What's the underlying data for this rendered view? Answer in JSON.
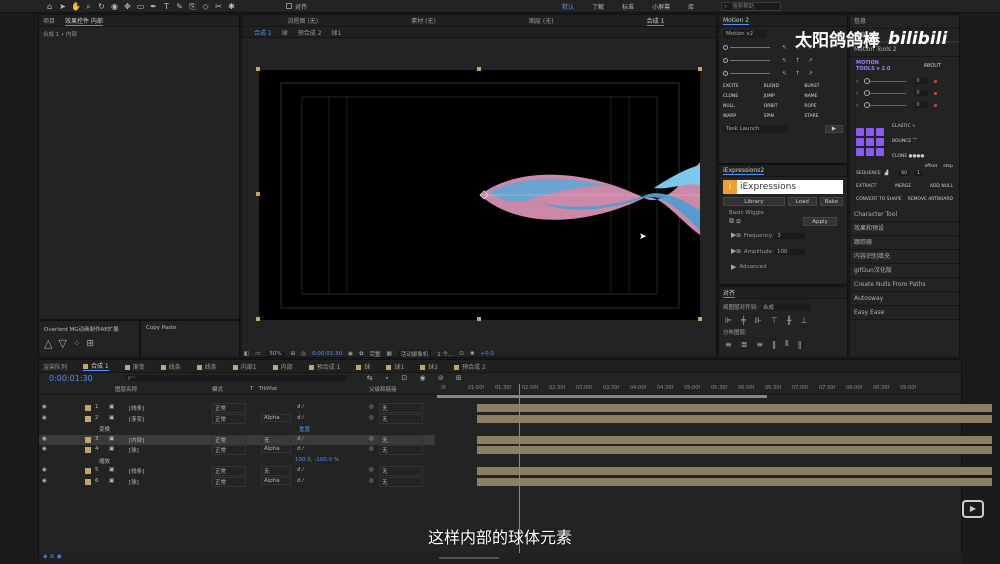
{
  "topbar": {
    "icons": [
      "home-icon",
      "selection-icon",
      "hand-icon",
      "zoom-icon",
      "rotate-icon",
      "camera-icon",
      "pan-icon",
      "rect-icon",
      "pen-icon",
      "text-icon",
      "brush-icon",
      "stamp-icon",
      "eraser-icon",
      "roto-icon",
      "puppet-icon"
    ],
    "snap_label": "对齐",
    "workspaces": [
      "默认",
      "了解",
      "标准",
      "小屏幕",
      "库"
    ],
    "search_placeholder": "搜索帮助"
  },
  "project_panel": {
    "tabs": [
      "项目",
      "效果控件 内部"
    ],
    "breadcrumb": "合成 1 • 内部"
  },
  "viewer": {
    "tabs": [
      "流程图 (无)",
      "素材 (无)",
      "图层 (无)",
      "合成 1"
    ],
    "subtabs": [
      "合成 1",
      "球",
      "预合成 2",
      "球1"
    ],
    "zoom": "50%",
    "timecode": "0:00:01:30",
    "quality": "完整",
    "camera": "活动摄像机",
    "views": "1 个...",
    "exposure": "+0.0"
  },
  "bottom_panels": [
    {
      "title": "Overlord MG动画制作AE扩展"
    },
    {
      "title": "Copy Paste"
    }
  ],
  "motion2": {
    "title": "Motion 2",
    "version": "Motion v2",
    "buttons": [
      "EXCITE",
      "BLEND",
      "BURST",
      "CLONE",
      "JUMP",
      "NAME",
      "NULL",
      "ORBIT",
      "ROPE",
      "WARP",
      "SPIN",
      "STARE"
    ],
    "task": "Task Launch"
  },
  "iexpressions": {
    "title": "iExpressions2",
    "logo": "iExpressions",
    "library": "Library",
    "load": "Load",
    "bake": "Bake",
    "section": "Basic Wiggle",
    "apply": "Apply",
    "frequency_label": "Frequency",
    "frequency": "3",
    "amplitude_label": "Amplitude",
    "amplitude": "100",
    "advanced": "Advanced"
  },
  "align": {
    "title": "对齐",
    "align_to_label": "将图层对齐到:",
    "align_to": "合成",
    "distribute": "分布图层:"
  },
  "right_panel": {
    "tabs": [
      "信息",
      "预览"
    ],
    "motion_tools": "Motion Tools 2",
    "mt_logo_1": "MOTION",
    "mt_logo_2": "TOOLS v 2.0",
    "about": "ABOUT",
    "values": [
      "0",
      "0",
      "0"
    ],
    "elastic": "ELASTIC",
    "bounce": "BOUNCE",
    "clone": "CLONE",
    "offset": "offset",
    "step": "step",
    "sequence": "SEQUENCE",
    "seq_offset": "60",
    "seq_step": "1",
    "extract": "EXTRACT",
    "merge": "MERGE",
    "add_null": "ADD NULL",
    "convert": "CONVERT TO SHAPE",
    "remove_artboard": "REMOVE ARTBOARD",
    "items": [
      "Character Tool",
      "效果和预设",
      "跟踪器",
      "内容识别填充",
      "gifGun汉化版",
      "Create Nulls From Paths",
      "Autosway",
      "Easy Ease"
    ]
  },
  "watermark": {
    "title": "太阳鸽鸽棒",
    "brand": "bilibili"
  },
  "timeline": {
    "tabs": [
      "渲染队列",
      "合成 1",
      "渐变",
      "线条",
      "线条",
      "内部1",
      "内部",
      "预合成 1",
      "球",
      "球1",
      "球2",
      "预合成 2"
    ],
    "timecode": "0:00:01:30",
    "search_placeholder": "ρ~",
    "header": {
      "name": "图层名称",
      "mode": "模式",
      "t": "T",
      "trkmat": "TrkMat",
      "parent": "父级和链接"
    },
    "layers": [
      {
        "num": "1",
        "name": "[线条]",
        "mode": "正常",
        "trk": "",
        "parent": "无"
      },
      {
        "num": "2",
        "name": "[渐变]",
        "mode": "正常",
        "trk": "Alpha",
        "parent": "无"
      },
      {
        "num": "",
        "name": "变换",
        "mode": "",
        "trk": "",
        "parent": ""
      },
      {
        "num": "3",
        "name": "[内部]",
        "mode": "正常",
        "trk": "无",
        "parent": "无"
      },
      {
        "num": "4",
        "name": "[球]",
        "mode": "正常",
        "trk": "Alpha",
        "parent": "无"
      },
      {
        "num": "",
        "name": "缩放",
        "mode": "",
        "trk": "",
        "parent": ""
      },
      {
        "num": "5",
        "name": "[线条]",
        "mode": "正常",
        "trk": "无",
        "parent": "无"
      },
      {
        "num": "6",
        "name": "[球]",
        "mode": "正常",
        "trk": "Alpha",
        "parent": "无"
      }
    ],
    "transform_reset": "重置",
    "scale_value": "100.0, -100.0 %",
    "ruler": [
      "0f",
      "01:00f",
      "01:30f",
      "02:00f",
      "02:30f",
      "03:00f",
      "03:30f",
      "04:00f",
      "04:30f",
      "05:00f",
      "05:30f",
      "06:00f",
      "06:30f",
      "07:00f",
      "07:30f",
      "08:00f",
      "08:30f",
      "09:00f"
    ]
  },
  "subtitle": "这样内部的球体元素"
}
